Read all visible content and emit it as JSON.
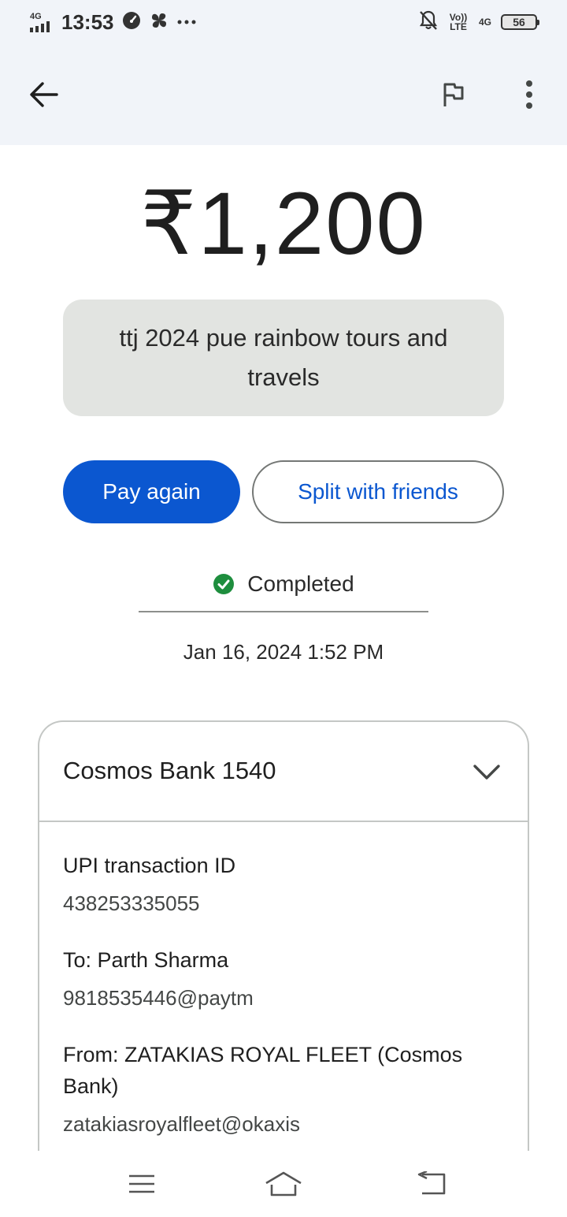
{
  "status_bar": {
    "network_label": "4G",
    "time": "13:53",
    "volte_label": "Vo)) LTE",
    "data_label": "4G",
    "battery": "56"
  },
  "amount": "₹1,200",
  "note": "ttj 2024 pue rainbow tours and travels",
  "actions": {
    "pay_again": "Pay again",
    "split": "Split with friends"
  },
  "status": "Completed",
  "date": "Jan 16, 2024 1:52 PM",
  "card": {
    "bank": "Cosmos Bank 1540",
    "upi_label": "UPI transaction ID",
    "upi_id": "438253335055",
    "to_label": "To: Parth Sharma",
    "to_value": "9818535446@paytm",
    "from_label": "From: ZATAKIAS ROYAL FLEET (Cosmos Bank)",
    "from_value": "zatakiasroyalfleet@okaxis"
  },
  "icons": {
    "back": "back-arrow-icon",
    "flag": "flag-icon",
    "more": "more-vert-icon",
    "check": "check-circle-icon",
    "expand": "chevron-down-icon",
    "nav_menu": "menu-icon",
    "nav_home": "home-icon",
    "nav_back": "back-icon"
  },
  "colors": {
    "primary": "#0b57d0",
    "success": "#1e8e3e",
    "note_bg": "#e2e4e1",
    "header_bg": "#f1f4f9"
  }
}
